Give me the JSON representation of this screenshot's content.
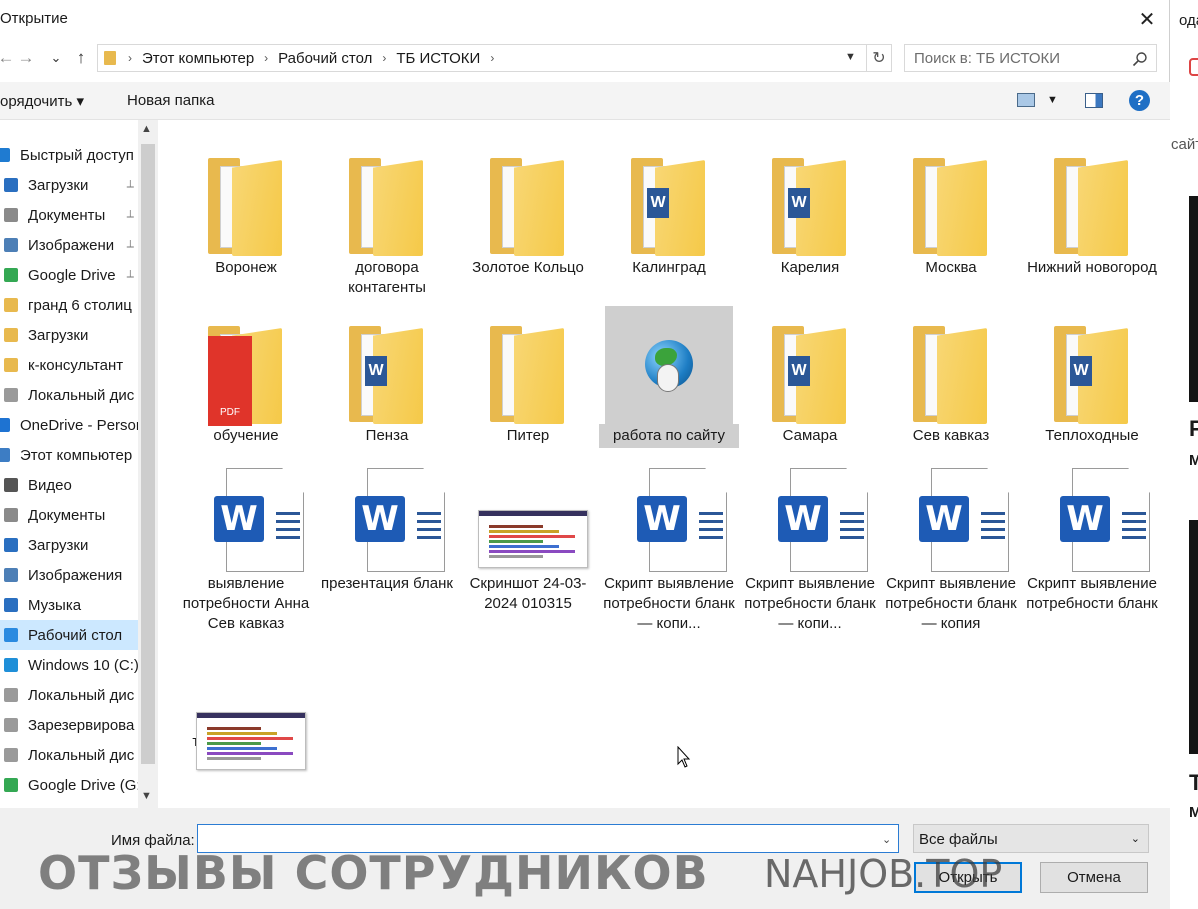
{
  "window": {
    "title": "Открытие",
    "close_glyph": "✕"
  },
  "nav": {
    "back_glyph": "←",
    "forward_glyph": "→",
    "recent_glyph": "⌄",
    "up_glyph": "↑",
    "breadcrumbs": [
      "Этот компьютер",
      "Рабочий стол",
      "ТБ ИСТОКИ"
    ],
    "breadcrumb_sep": "›",
    "refresh_glyph": "↻",
    "search_placeholder": "Поиск в: ТБ ИСТОКИ"
  },
  "toolbar": {
    "organize_label": "орядочить ▾",
    "new_folder_label": "Новая папка",
    "help_glyph": "?"
  },
  "sidebar": {
    "items": [
      {
        "label": "Быстрый доступ",
        "icon": "star-icon",
        "color": "#1f7bd1",
        "pinned": false
      },
      {
        "label": "Загрузки",
        "icon": "download-icon",
        "color": "#2a6fc0",
        "pinned": true
      },
      {
        "label": "Документы",
        "icon": "document-icon",
        "color": "#8a8a8a",
        "pinned": true
      },
      {
        "label": "Изображени",
        "icon": "image-icon",
        "color": "#4d7fb6",
        "pinned": true
      },
      {
        "label": "Google Drive",
        "icon": "google-drive-icon",
        "color": "#34a853",
        "pinned": true
      },
      {
        "label": "гранд 6 столиц",
        "icon": "folder-icon",
        "color": "#e8b94e",
        "pinned": false
      },
      {
        "label": "Загрузки",
        "icon": "folder-icon",
        "color": "#e8b94e",
        "pinned": false
      },
      {
        "label": "к-консультант",
        "icon": "folder-icon",
        "color": "#e8b94e",
        "pinned": false
      },
      {
        "label": "Локальный дис",
        "icon": "drive-icon",
        "color": "#9a9a9a",
        "pinned": false
      },
      {
        "label": "OneDrive - Person",
        "icon": "onedrive-icon",
        "color": "#1e73d2",
        "pinned": false
      },
      {
        "label": "Этот компьютер",
        "icon": "computer-icon",
        "color": "#3d7dc4",
        "pinned": false
      },
      {
        "label": "Видео",
        "icon": "video-icon",
        "color": "#555555",
        "pinned": false
      },
      {
        "label": "Документы",
        "icon": "document-icon",
        "color": "#8a8a8a",
        "pinned": false
      },
      {
        "label": "Загрузки",
        "icon": "download-icon",
        "color": "#2a6fc0",
        "pinned": false
      },
      {
        "label": "Изображения",
        "icon": "image-icon",
        "color": "#4d7fb6",
        "pinned": false
      },
      {
        "label": "Музыка",
        "icon": "music-icon",
        "color": "#2a6fc0",
        "pinned": false
      },
      {
        "label": "Рабочий стол",
        "icon": "desktop-icon",
        "color": "#2a8ae0",
        "pinned": false,
        "selected": true
      },
      {
        "label": "Windows 10 (C:)",
        "icon": "windows-drive-icon",
        "color": "#1f8fd8",
        "pinned": false
      },
      {
        "label": "Локальный дис",
        "icon": "drive-icon",
        "color": "#9a9a9a",
        "pinned": false
      },
      {
        "label": "Зарезервирова",
        "icon": "drive-icon",
        "color": "#9a9a9a",
        "pinned": false
      },
      {
        "label": "Локальный дис",
        "icon": "drive-icon",
        "color": "#9a9a9a",
        "pinned": false
      },
      {
        "label": "Google Drive (G:",
        "icon": "google-drive-icon",
        "color": "#34a853",
        "pinned": false
      }
    ],
    "pin_glyph": "📌",
    "scroll_up_glyph": "▲",
    "scroll_down_glyph": "▼"
  },
  "files": [
    {
      "label": "Воронеж",
      "type": "folder",
      "variant": "doc"
    },
    {
      "label": "договора контагенты",
      "type": "folder",
      "variant": "doc"
    },
    {
      "label": "Золотое Кольцо",
      "type": "folder",
      "variant": "doc"
    },
    {
      "label": "Калинград",
      "type": "folder",
      "variant": "word"
    },
    {
      "label": "Карелия",
      "type": "folder",
      "variant": "word"
    },
    {
      "label": "Москва",
      "type": "folder",
      "variant": "doc"
    },
    {
      "label": "Нижний новогород",
      "type": "folder",
      "variant": "doc"
    },
    {
      "label": "обучение",
      "type": "folder",
      "variant": "pdf",
      "badge": "PDF"
    },
    {
      "label": "Пенза",
      "type": "folder",
      "variant": "word"
    },
    {
      "label": "Питер",
      "type": "folder",
      "variant": "doc"
    },
    {
      "label": "работа по сайту",
      "type": "shortcut",
      "selected": true
    },
    {
      "label": "Самара",
      "type": "folder",
      "variant": "word"
    },
    {
      "label": "Сев кавказ",
      "type": "folder",
      "variant": "doc"
    },
    {
      "label": "Теплоходные",
      "type": "folder",
      "variant": "word"
    },
    {
      "label": "выявление потребности Анна Сев кавказ",
      "type": "word"
    },
    {
      "label": "презентация бланк",
      "type": "word"
    },
    {
      "label": "Скриншот 24-03-2024 010315",
      "type": "image"
    },
    {
      "label": "Скрипт выявление потребности бланк — копи...",
      "type": "word"
    },
    {
      "label": "Скрипт выявление потребности бланк — копи...",
      "type": "word"
    },
    {
      "label": "Скрипт выявление потребности бланк — копия",
      "type": "word"
    },
    {
      "label": "Скрипт выявление потребности бланк",
      "type": "word"
    },
    {
      "label": "тест векторный",
      "type": "image"
    }
  ],
  "footer": {
    "filename_label": "Имя файла:",
    "filename_value": "",
    "filename_drop_glyph": "⌄",
    "filetype_value": "Все файлы",
    "filetype_drop_glyph": "⌄",
    "open_label": "Открыть",
    "cancel_label": "Отмена"
  },
  "background": {
    "top_text": "одат",
    "mid_text": "сайт",
    "big_letter_1": "F",
    "small_letter_1": "M",
    "big_letter_2": "T",
    "small_letter_2": "M"
  },
  "watermark": {
    "left_text": "ОТЗЫВЫ СОТРУДНИКОВ",
    "right_text": "NAHJOB.TOP"
  },
  "colors": {
    "accent": "#0078d7",
    "selection": "#cce8ff",
    "folder": "#f5c948",
    "word": "#1e5bb5"
  }
}
